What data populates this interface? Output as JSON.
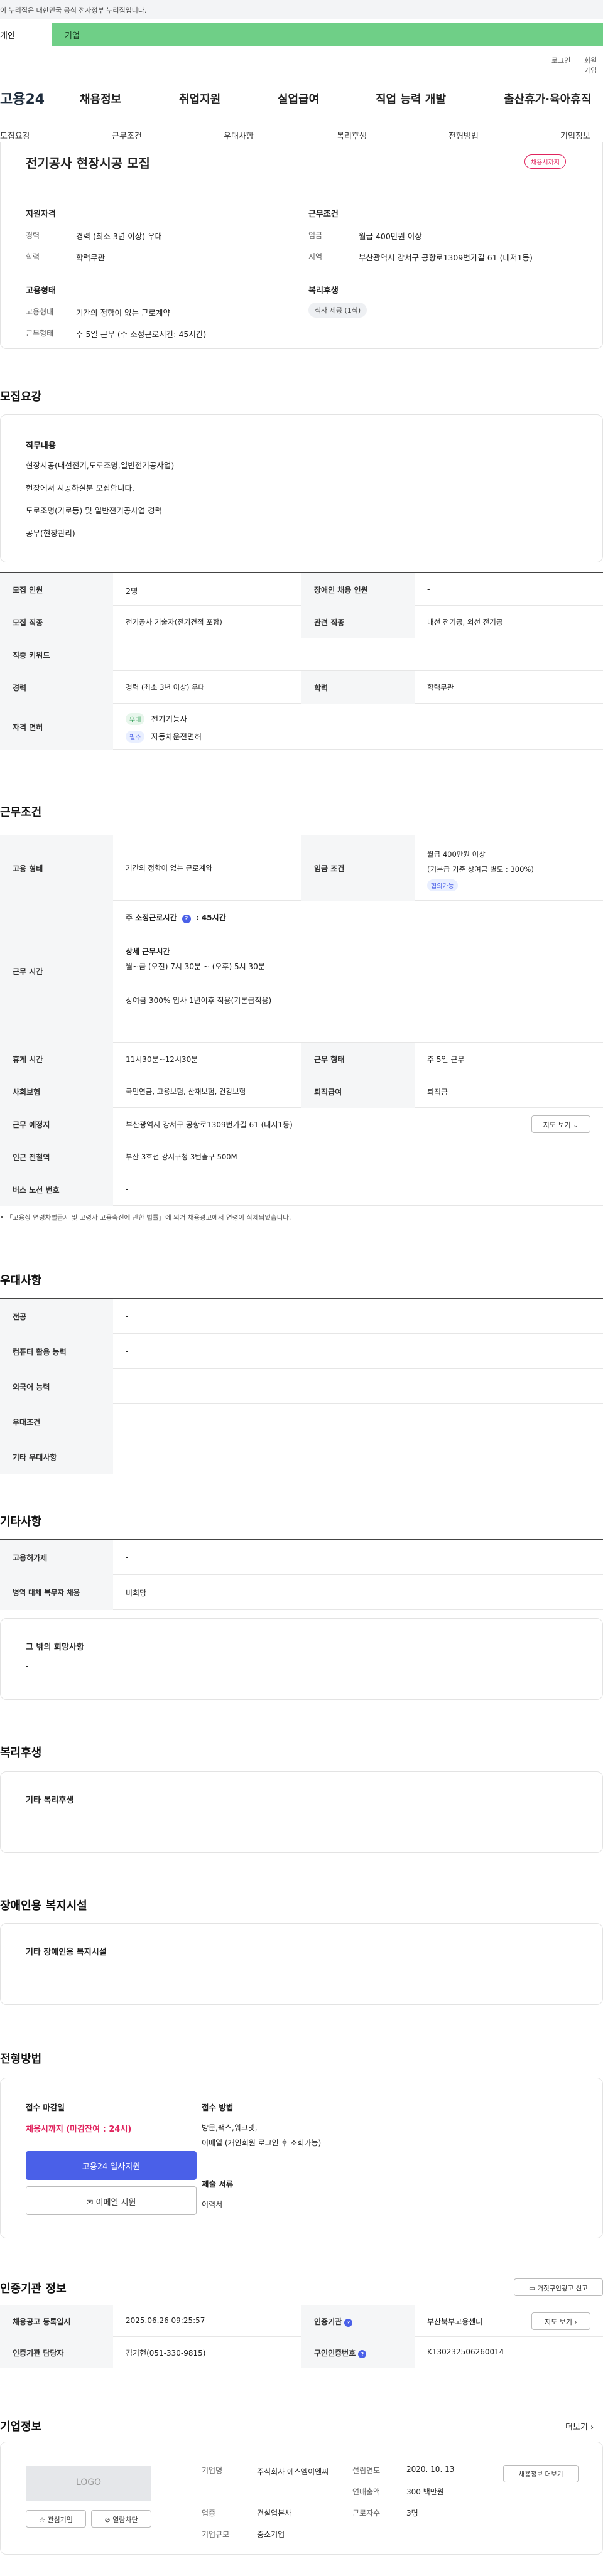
{
  "topbar": {
    "gov_notice": "이 누리집은 대한민국 공식 전자정부 누리집입니다."
  },
  "user_tabs": {
    "personal": "개인",
    "company": "기업"
  },
  "util": {
    "login": "로그인",
    "join": "회원가입"
  },
  "header": {
    "logo": "고용24",
    "nav": [
      "채용정보",
      "취업지원",
      "실업급여",
      "직업 능력 개발",
      "출산휴가·육아휴직"
    ]
  },
  "tabs": [
    "모집요강",
    "근무조건",
    "우대사항",
    "복리후생",
    "전형방법",
    "기업정보"
  ],
  "summary": {
    "title": "전기공사 현장시공 모집",
    "status": "채용시까지",
    "qual_title": "지원자격",
    "career_label": "경력",
    "career_value": "경력 (최소 3년 이상) 우대",
    "edu_label": "학력",
    "edu_value": "학력무관",
    "cond_title": "근무조건",
    "wage_label": "임금",
    "wage_value": "월급 400만원 이상",
    "region_label": "지역",
    "region_value": "부산광역시 강서구 공항로1309번가길 61 (대저1동)",
    "emp_title": "고용형태",
    "emp_type_label": "고용형태",
    "emp_type_value": "기간의 정함이 없는 근로계약",
    "work_label": "근무형태",
    "work_value": "주 5일 근무 (주 소정근로시간: 45시간)",
    "welfare_title": "복리후생",
    "welfare_tag": "식사 제공 (1식)"
  },
  "recruit": {
    "section_title": "모집요강",
    "duty_title": "직무내용",
    "duty_lines": [
      "현장시공(내선전기,도로조명,일반전기공사업)",
      "현장에서 시공하실분 모집합니다.",
      "도로조명(가로등) 및 일반전기공사업 경력",
      "공무(현장관리)"
    ],
    "rows": [
      {
        "k1": "모집 인원",
        "v1": "2명",
        "k2": "장애인 채용 인원",
        "v2": "-"
      },
      {
        "k1": "모집 직종",
        "v1": "전기공사 기술자(전기견적 포함)",
        "k2": "관련 직종",
        "v2": "내선 전기공, 외선 전기공"
      },
      {
        "k1": "직종 키워드",
        "v1": "-"
      },
      {
        "k1": "경력",
        "v1": "경력 (최소 3년 이상) 우대",
        "k2": "학력",
        "v2": "학력무관"
      }
    ],
    "license_label": "자격 면허",
    "licenses": [
      {
        "tag": "우대",
        "name": "전기기능사"
      },
      {
        "tag": "필수",
        "name": "자동차운전면허"
      }
    ]
  },
  "conditions": {
    "section_title": "근무조건",
    "emp_label": "고용 형태",
    "emp_value": "기간의 정함이 없는 근로계약",
    "wage_label": "임금 조건",
    "wage_line1": "월급 400만원 이상",
    "wage_line2": "(기본급 기준 상여금 별도 : 300%)",
    "wage_tag": "협의가능",
    "hours_label": "근무 시간",
    "hours_total_label": "주 소정근로시간",
    "hours_total_value": "45시간",
    "hours_detail_title": "상세 근무시간",
    "hours_detail": "월~금 (오전) 7시 30분 ~ (오후) 5시 30분",
    "hours_note": "상여금 300% 입사 1년이후 적용(기본급적용)",
    "break_label": "휴게 시간",
    "break_value": "11시30분~12시30분",
    "worktype_label": "근무 형태",
    "worktype_value": "주 5일 근무",
    "insurance_label": "사회보험",
    "insurance_value": "국민연금, 고용보험, 산재보험, 건강보험",
    "severance_label": "퇴직급여",
    "severance_value": "퇴직금",
    "location_label": "근무 예정지",
    "location_value": "부산광역시 강서구 공항로1309번가길 61 (대저1동)",
    "map_btn": "지도 보기",
    "subway_label": "인근 전철역",
    "subway_value": "부산 3호선 강서구청 3번출구 500M",
    "bus_label": "버스 노선 번호",
    "bus_value": "-",
    "note": "「고용상 연령차별금지 및 고령자 고용촉진에 관한 법률」에 의거 채용광고에서 연령이 삭제되었습니다."
  },
  "preference": {
    "section_title": "우대사항",
    "rows": [
      {
        "k": "전공",
        "v": "-"
      },
      {
        "k": "컴퓨터 활용 능력",
        "v": "-"
      },
      {
        "k": "외국어 능력",
        "v": "-"
      },
      {
        "k": "우대조건",
        "v": "-"
      },
      {
        "k": "기타 우대사항",
        "v": "-"
      }
    ]
  },
  "other": {
    "section_title": "기타사항",
    "rows": [
      {
        "k": "고용허가제",
        "v": "-"
      },
      {
        "k": "병역 대체 복무자 채용",
        "v": "비희망"
      }
    ],
    "box_title": "그 밖의 희망사항",
    "box_value": "-"
  },
  "welfare": {
    "section_title": "복리후생",
    "box_title": "기타 복리후생",
    "box_value": "-"
  },
  "disability": {
    "section_title": "장애인용 복지시설",
    "box_title": "기타 장애인용 복지시설",
    "box_value": "-"
  },
  "screening": {
    "section_title": "전형방법",
    "deadline_title": "접수 마감일",
    "deadline_value": "채용시까지 (마감잔여 : 24시)",
    "apply_btn": "고용24 입사지원",
    "email_btn": "이메일 지원",
    "method_title": "접수 방법",
    "method_line1": "방문,팩스,워크넷,",
    "method_line2": "이메일 (개인회원 로그인 후 조회가능)",
    "docs_title": "제출 서류",
    "docs_value": "이력서"
  },
  "agency": {
    "section_title": "인증기관 정보",
    "copy_btn": "거짓구인광고 신고",
    "reg_label": "채용공고 등록일시",
    "reg_value": "2025.06.26 09:25:57",
    "agency_label": "인증기관",
    "agency_value": "부산북부고용센터",
    "map_btn": "지도 보기",
    "manager_label": "인증기관 담당자",
    "manager_value": "김기현(051-330-9815)",
    "id_label": "구인인증번호",
    "id_value": "K130232506260014"
  },
  "company": {
    "section_title": "기업정보",
    "more": "더보기",
    "logo_text": "LOGO",
    "fav_btn": "관심기업",
    "block_btn": "열람차단",
    "name_label": "기업명",
    "name_value": "주식회사 에스엠이엔씨",
    "industry_label": "업종",
    "industry_value": "건설업본사",
    "scale_label": "기업규모",
    "scale_value": "중소기업",
    "founded_label": "설립연도",
    "founded_value": "2020. 10. 13",
    "sales_label": "연매출액",
    "sales_value": "300 백만원",
    "employees_label": "근로자수",
    "employees_value": "3명",
    "jobs_btn": "채용정보 더보기"
  },
  "colors": {
    "accent": "#4a60e8",
    "brand_green": "#6fcf87",
    "status_pink": "#e0245e"
  }
}
